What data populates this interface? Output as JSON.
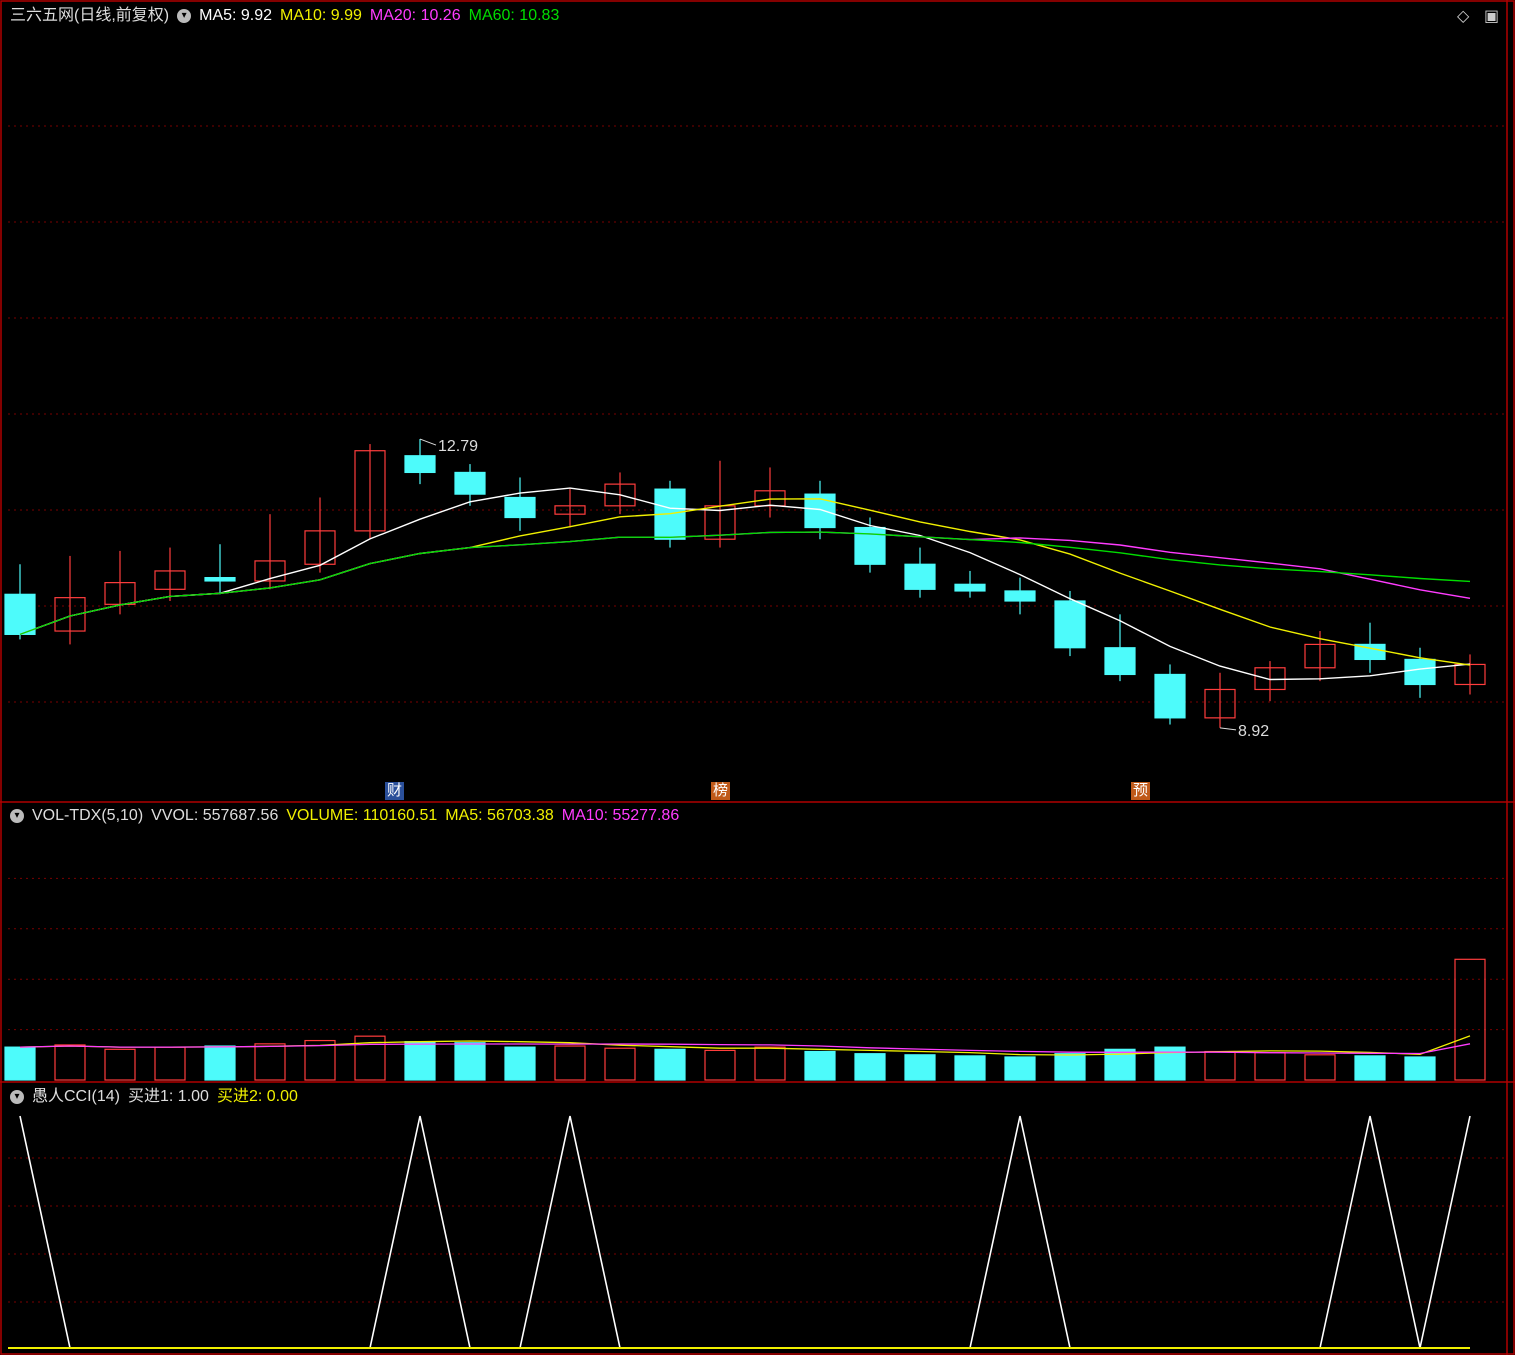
{
  "main_header": {
    "title": "三六五网(日线,前复权)",
    "ma5": "MA5: 9.92",
    "ma10": "MA10: 9.99",
    "ma20": "MA20: 10.26",
    "ma60": "MA60: 10.83"
  },
  "vol_header": {
    "name": "VOL-TDX(5,10)",
    "vvol": "VVOL: 557687.56",
    "volume": "VOLUME: 110160.51",
    "ma5": "MA5: 56703.38",
    "ma10": "MA10: 55277.86"
  },
  "cci_header": {
    "name": "愚人CCI(14)",
    "buy1": "买进1: 1.00",
    "buy2": "买进2: 0.00"
  },
  "markers": {
    "cai": "财",
    "bang": "榜",
    "yu": "预"
  },
  "colors": {
    "up": "#ff3d3d",
    "down": "#4dfbfb",
    "ma5": "#ffffff",
    "ma10": "#f0f000",
    "ma20": "#ff3cff",
    "ma60": "#00dd00",
    "grid": "#7a0000",
    "border": "#b00000"
  },
  "chart_data": [
    {
      "type": "candlestick",
      "price_range": [
        8.5,
        13.1
      ],
      "high_label": "12.79",
      "low_label": "8.92",
      "candles": [
        [
          9.72,
          9.48,
          9.9,
          9.45
        ],
        [
          9.5,
          9.7,
          9.95,
          9.42
        ],
        [
          9.66,
          9.79,
          9.98,
          9.6
        ],
        [
          9.75,
          9.86,
          10.0,
          9.68
        ],
        [
          9.82,
          9.8,
          10.02,
          9.72
        ],
        [
          9.8,
          9.92,
          10.2,
          9.75
        ],
        [
          9.9,
          10.1,
          10.3,
          9.85
        ],
        [
          10.1,
          10.58,
          10.62,
          10.05
        ],
        [
          10.55,
          10.45,
          10.65,
          10.38
        ],
        [
          10.45,
          10.32,
          10.5,
          10.25
        ],
        [
          10.3,
          10.18,
          10.42,
          10.1
        ],
        [
          10.2,
          10.25,
          10.35,
          10.12
        ],
        [
          10.25,
          10.38,
          10.45,
          10.2
        ],
        [
          10.35,
          10.05,
          10.4,
          10.0
        ],
        [
          10.05,
          10.25,
          10.52,
          10.0
        ],
        [
          10.25,
          10.34,
          10.48,
          10.18
        ],
        [
          10.32,
          10.12,
          10.4,
          10.05
        ],
        [
          10.12,
          9.9,
          10.18,
          9.85
        ],
        [
          9.9,
          9.75,
          10.0,
          9.7
        ],
        [
          9.78,
          9.74,
          9.86,
          9.7
        ],
        [
          9.74,
          9.68,
          9.82,
          9.6
        ],
        [
          9.68,
          9.4,
          9.74,
          9.35
        ],
        [
          9.4,
          9.24,
          9.6,
          9.2
        ],
        [
          9.24,
          8.98,
          9.3,
          8.94
        ],
        [
          8.98,
          9.15,
          9.25,
          8.92
        ],
        [
          9.15,
          9.28,
          9.32,
          9.08
        ],
        [
          9.28,
          9.42,
          9.5,
          9.2
        ],
        [
          9.42,
          9.33,
          9.55,
          9.25
        ],
        [
          9.33,
          9.18,
          9.4,
          9.1
        ],
        [
          9.18,
          9.3,
          9.36,
          9.12
        ]
      ],
      "vol_range": [
        0,
        230000
      ],
      "volumes": [
        30000,
        32000,
        28000,
        30000,
        31000,
        33000,
        36000,
        40000,
        35000,
        34000,
        30000,
        31000,
        29000,
        28000,
        27000,
        30000,
        26000,
        24000,
        23000,
        22000,
        21000,
        24000,
        28000,
        30000,
        26000,
        25000,
        23000,
        22000,
        21000,
        110160.51
      ]
    },
    {
      "type": "line",
      "name": "愚人CCI(14)",
      "ylim": [
        0,
        1
      ],
      "values": [
        1,
        0,
        0,
        0,
        0,
        0,
        0,
        0,
        1,
        0,
        0,
        1,
        0,
        0,
        0,
        0,
        0,
        0,
        0,
        0,
        1,
        0,
        0,
        0,
        0,
        0,
        0,
        1,
        0,
        1
      ]
    }
  ]
}
